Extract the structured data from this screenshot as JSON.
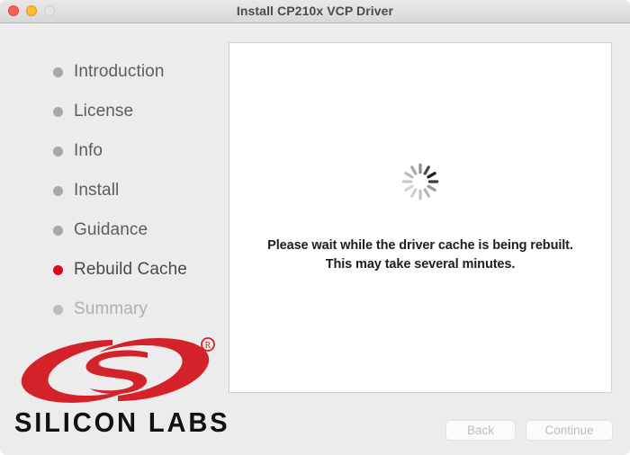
{
  "window": {
    "title": "Install CP210x VCP Driver",
    "traffic_lights": [
      {
        "name": "close",
        "color": "#ff5f57",
        "enabled": true
      },
      {
        "name": "minimize",
        "color": "#febc2e",
        "enabled": true
      },
      {
        "name": "zoom",
        "color": "#e4e4e4",
        "enabled": false
      }
    ]
  },
  "sidebar": {
    "steps": [
      {
        "label": "Introduction",
        "state": "done"
      },
      {
        "label": "License",
        "state": "done"
      },
      {
        "label": "Info",
        "state": "done"
      },
      {
        "label": "Install",
        "state": "done"
      },
      {
        "label": "Guidance",
        "state": "done"
      },
      {
        "label": "Rebuild Cache",
        "state": "active"
      },
      {
        "label": "Summary",
        "state": "upcoming"
      }
    ],
    "logo": {
      "icon_name": "silicon-labs-swirl-logo",
      "wordmark": "SILICON LABS",
      "registered_mark": "®",
      "brand_color": "#D3222A"
    }
  },
  "main": {
    "spinner": {
      "icon_name": "loading-spinner-icon",
      "spokes": 12
    },
    "message_line1": "Please wait while the driver cache is being rebuilt.",
    "message_line2": "This may take several minutes."
  },
  "footer": {
    "back_label": "Back",
    "back_enabled": false,
    "continue_label": "Continue",
    "continue_enabled": false
  },
  "colors": {
    "accent_red": "#e2061c",
    "window_bg": "#ececec",
    "panel_bg": "#ffffff",
    "step_text": "#5d5d5d",
    "step_upcoming_text": "#b0b0b0"
  }
}
